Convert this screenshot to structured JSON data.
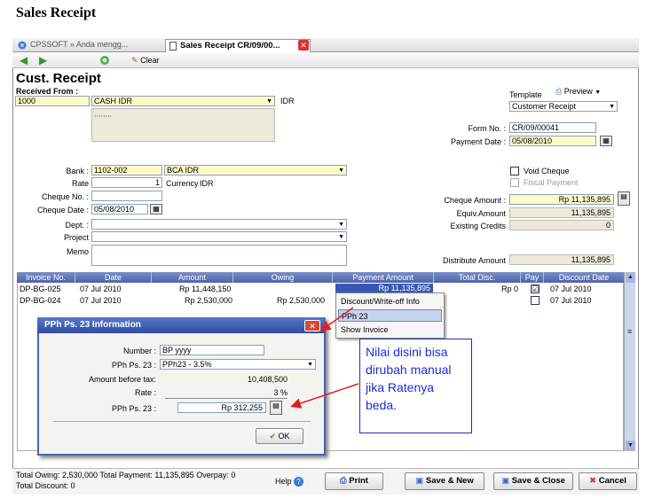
{
  "heading": "Sales Receipt",
  "tabs": [
    {
      "label": "CPSSOFT » Anda mengg..."
    },
    {
      "label": "Sales Receipt CR/09/00..."
    }
  ],
  "toolbar": {
    "clear_label": "Clear"
  },
  "form": {
    "title": "Cust. Receipt",
    "received_from_label": "Received From :",
    "customer_no": "1000",
    "customer_name": "CASH IDR",
    "currency_code": "IDR",
    "address_text": ",,,,,,,,",
    "template_label": "Template",
    "preview_label": "Preview",
    "template_value": "Customer Receipt",
    "form_no_label": "Form No. :",
    "form_no_value": "CR/09/00041",
    "payment_date_label": "Payment Date :",
    "payment_date_value": "05/08/2010",
    "bank_label": "Bank :",
    "bank_code": "1102-002",
    "bank_name": "BCA IDR",
    "rate_label": "Rate",
    "rate_value": "1",
    "currency_label": "Currency",
    "currency_value": "IDR",
    "cheque_no_label": "Cheque No. :",
    "cheque_date_label": "Cheque Date :",
    "cheque_date_value": "05/08/2010",
    "dept_label": "Dept. :",
    "project_label": "Project",
    "memo_label": "Memo",
    "void_cheque_label": "Void Cheque",
    "fiscal_payment_label": "Fiscal Payment",
    "cheque_amount_label": "Cheque Amount :",
    "cheque_amount_value": "Rp 11,135,895",
    "equiv_amount_label": "Equiv.Amount",
    "equiv_amount_value": "11,135,895",
    "existing_credits_label": "Existing Credits",
    "existing_credits_value": "0",
    "distribute_amount_label": "Distribute Amount",
    "distribute_amount_value": "11,135,895"
  },
  "grid": {
    "columns": [
      "Invoice No.",
      "Date",
      "Amount",
      "Owing",
      "Payment Amount",
      "Total Disc.",
      "Pay",
      "Discount Date"
    ],
    "rows": [
      {
        "invoice": "DP-BG-025",
        "date": "07 Jul 2010",
        "amount": "Rp 11,448,150",
        "owing": "",
        "payment": "Rp 11,135,895",
        "disc": "Rp 0",
        "pay": "☑",
        "disc_date": "07 Jul 2010"
      },
      {
        "invoice": "DP-BG-024",
        "date": "07 Jul 2010",
        "amount": "Rp 2,530,000",
        "owing": "Rp 2,530,000",
        "payment": "",
        "disc": "",
        "pay": "",
        "disc_date": "07 Jul 2010"
      }
    ]
  },
  "context_menu": {
    "items": [
      "Discount/Write-off Info",
      "PPh 23",
      "Show Invoice"
    ]
  },
  "dialog": {
    "title": "PPh Ps. 23 Information",
    "number_label": "Number :",
    "number_value": "BP yyyy",
    "pph_label": "PPh Ps. 23 :",
    "pph_value": "PPh23 - 3.5%",
    "amount_before_tax_label": "Amount before tax:",
    "amount_before_tax_value": "10,408,500",
    "rate_label": "Rate :",
    "rate_value": "3 %",
    "pph_amount_label": "PPh Ps. 23 :",
    "pph_amount_value": "Rp 312,255",
    "ok_label": "OK"
  },
  "callout": {
    "text": "Nilai disini bisa dirubah manual jika Ratenya beda."
  },
  "status": {
    "line1": "Total Owing: 2,530,000   Total Payment: 11,135,895   Overpay: 0",
    "line2": "Total Discount: 0",
    "help_label": "Help",
    "print_label": "Print",
    "save_new_label": "Save & New",
    "save_close_label": "Save & Close",
    "cancel_label": "Cancel"
  },
  "colors": {
    "callout_text": "#1a2cd6",
    "arrow": "#e02020",
    "grid_header": "#4f63a8"
  }
}
